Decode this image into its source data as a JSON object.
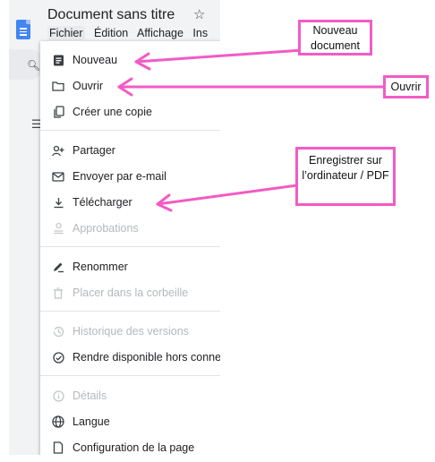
{
  "app": {
    "title": "Document sans titre",
    "menubar": [
      "Fichier",
      "Édition",
      "Affichage",
      "Ins"
    ]
  },
  "file_menu": {
    "items": [
      {
        "label": "Nouveau",
        "icon": "document-icon",
        "disabled": false
      },
      {
        "label": "Ouvrir",
        "icon": "folder-icon",
        "disabled": false
      },
      {
        "label": "Créer une copie",
        "icon": "copy-icon",
        "disabled": false
      },
      {
        "label": "Partager",
        "icon": "person-add-icon",
        "disabled": false
      },
      {
        "label": "Envoyer par e-mail",
        "icon": "mail-icon",
        "disabled": false
      },
      {
        "label": "Télécharger",
        "icon": "download-icon",
        "disabled": false
      },
      {
        "label": "Approbations",
        "icon": "approval-icon",
        "disabled": true
      },
      {
        "label": "Renommer",
        "icon": "rename-icon",
        "disabled": false
      },
      {
        "label": "Placer dans la corbeille",
        "icon": "trash-icon",
        "disabled": true
      },
      {
        "label": "Historique des versions",
        "icon": "history-icon",
        "disabled": true
      },
      {
        "label": "Rendre disponible hors conne",
        "icon": "offline-icon",
        "disabled": false
      },
      {
        "label": "Détails",
        "icon": "info-icon",
        "disabled": true
      },
      {
        "label": "Langue",
        "icon": "globe-icon",
        "disabled": false
      },
      {
        "label": "Configuration de la page",
        "icon": "page-setup-icon",
        "disabled": false
      }
    ]
  },
  "annotations": {
    "nouveau": "Nouveau document",
    "ouvrir": "Ouvrir",
    "telecharger": "Enregistrer sur l’ordinateur / PDF"
  },
  "colors": {
    "annotation_pink": "#f25bc5",
    "docs_blue": "#4285f4"
  }
}
